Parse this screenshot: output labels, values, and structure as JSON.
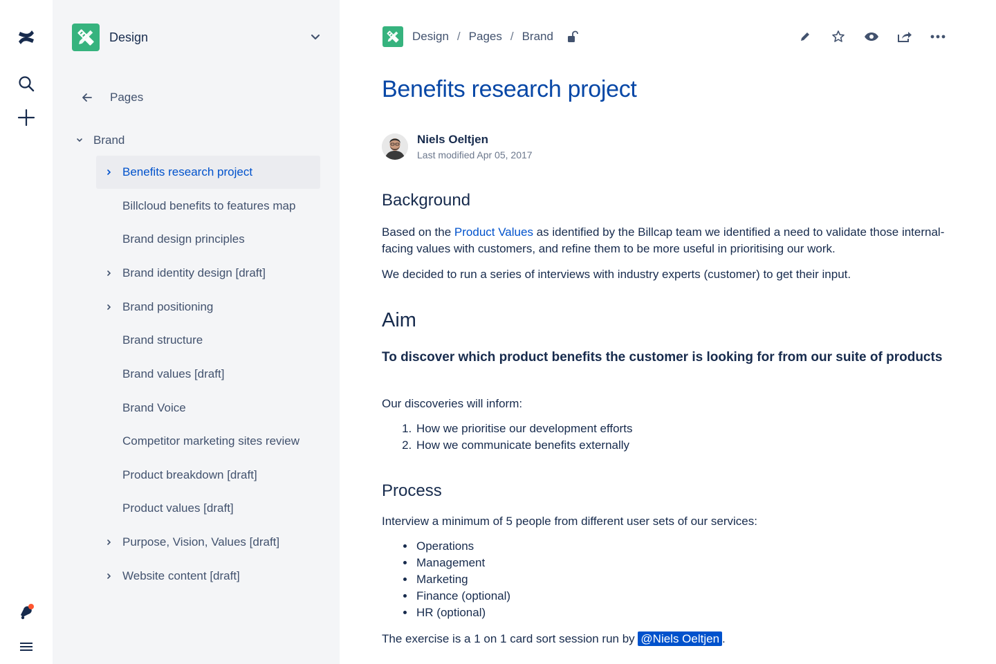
{
  "rail": {
    "icons": [
      "confluence-logo-icon",
      "search-icon",
      "create-plus-icon",
      "notifications-icon",
      "menu-icon"
    ],
    "notification_dot_color": "#FF5630"
  },
  "sidebar": {
    "space_name": "Design",
    "back_label": "Pages",
    "parent": "Brand",
    "items": [
      {
        "label": "Benefits research project",
        "expandable": true,
        "selected": true
      },
      {
        "label": "Billcloud benefits to features map",
        "expandable": false,
        "selected": false
      },
      {
        "label": "Brand design principles",
        "expandable": false,
        "selected": false
      },
      {
        "label": "Brand identity design [draft]",
        "expandable": true,
        "selected": false
      },
      {
        "label": "Brand positioning",
        "expandable": true,
        "selected": false
      },
      {
        "label": "Brand structure",
        "expandable": false,
        "selected": false
      },
      {
        "label": "Brand values [draft]",
        "expandable": false,
        "selected": false
      },
      {
        "label": "Brand Voice",
        "expandable": false,
        "selected": false
      },
      {
        "label": "Competitor marketing sites review",
        "expandable": false,
        "selected": false
      },
      {
        "label": "Product breakdown [draft]",
        "expandable": false,
        "selected": false
      },
      {
        "label": "Product values [draft]",
        "expandable": false,
        "selected": false
      },
      {
        "label": "Purpose, Vision, Values [draft]",
        "expandable": true,
        "selected": false
      },
      {
        "label": "Website content [draft]",
        "expandable": true,
        "selected": false
      }
    ]
  },
  "breadcrumb": {
    "items": [
      "Design",
      "Pages",
      "Brand"
    ],
    "separator": "/"
  },
  "toolbar": {
    "icons": [
      "edit-icon",
      "star-icon",
      "watch-icon",
      "share-icon",
      "more-icon"
    ]
  },
  "page": {
    "title": "Benefits research project",
    "author": "Niels Oeltjen",
    "modified": "Last modified Apr 05, 2017",
    "background_heading": "Background",
    "bg_p1_before": "Based on the ",
    "bg_p1_link": "Product Values",
    "bg_p1_after": " as identified by the Billcap team we identified a need to validate those internal-facing values with customers, and refine them to be more useful in prioritising our work.",
    "bg_p2": "We decided to run a series of interviews with industry experts (customer) to get their input.",
    "aim_heading": "Aim",
    "aim_bold": "To discover which product benefits the customer is looking for from our suite of products",
    "inform_intro": "Our discoveries will inform:",
    "inform_items": [
      "How we prioritise our development efforts",
      "How we communicate benefits externally"
    ],
    "process_heading": "Process",
    "process_intro": "Interview a minimum of 5 people from different user sets of our services:",
    "process_items": [
      "Operations",
      "Management",
      "Marketing",
      "Finance (optional)",
      "HR (optional)"
    ],
    "exercise_before": "The exercise is a 1 on 1 card sort session run by ",
    "exercise_mention": "@Niels Oeltjen",
    "exercise_after": "."
  },
  "colors": {
    "brand_blue": "#0052CC",
    "title_blue": "#0747A6",
    "space_green": "#36B37E",
    "sidebar_bg": "#F4F5F7",
    "selected_bg": "#EBECF0"
  }
}
